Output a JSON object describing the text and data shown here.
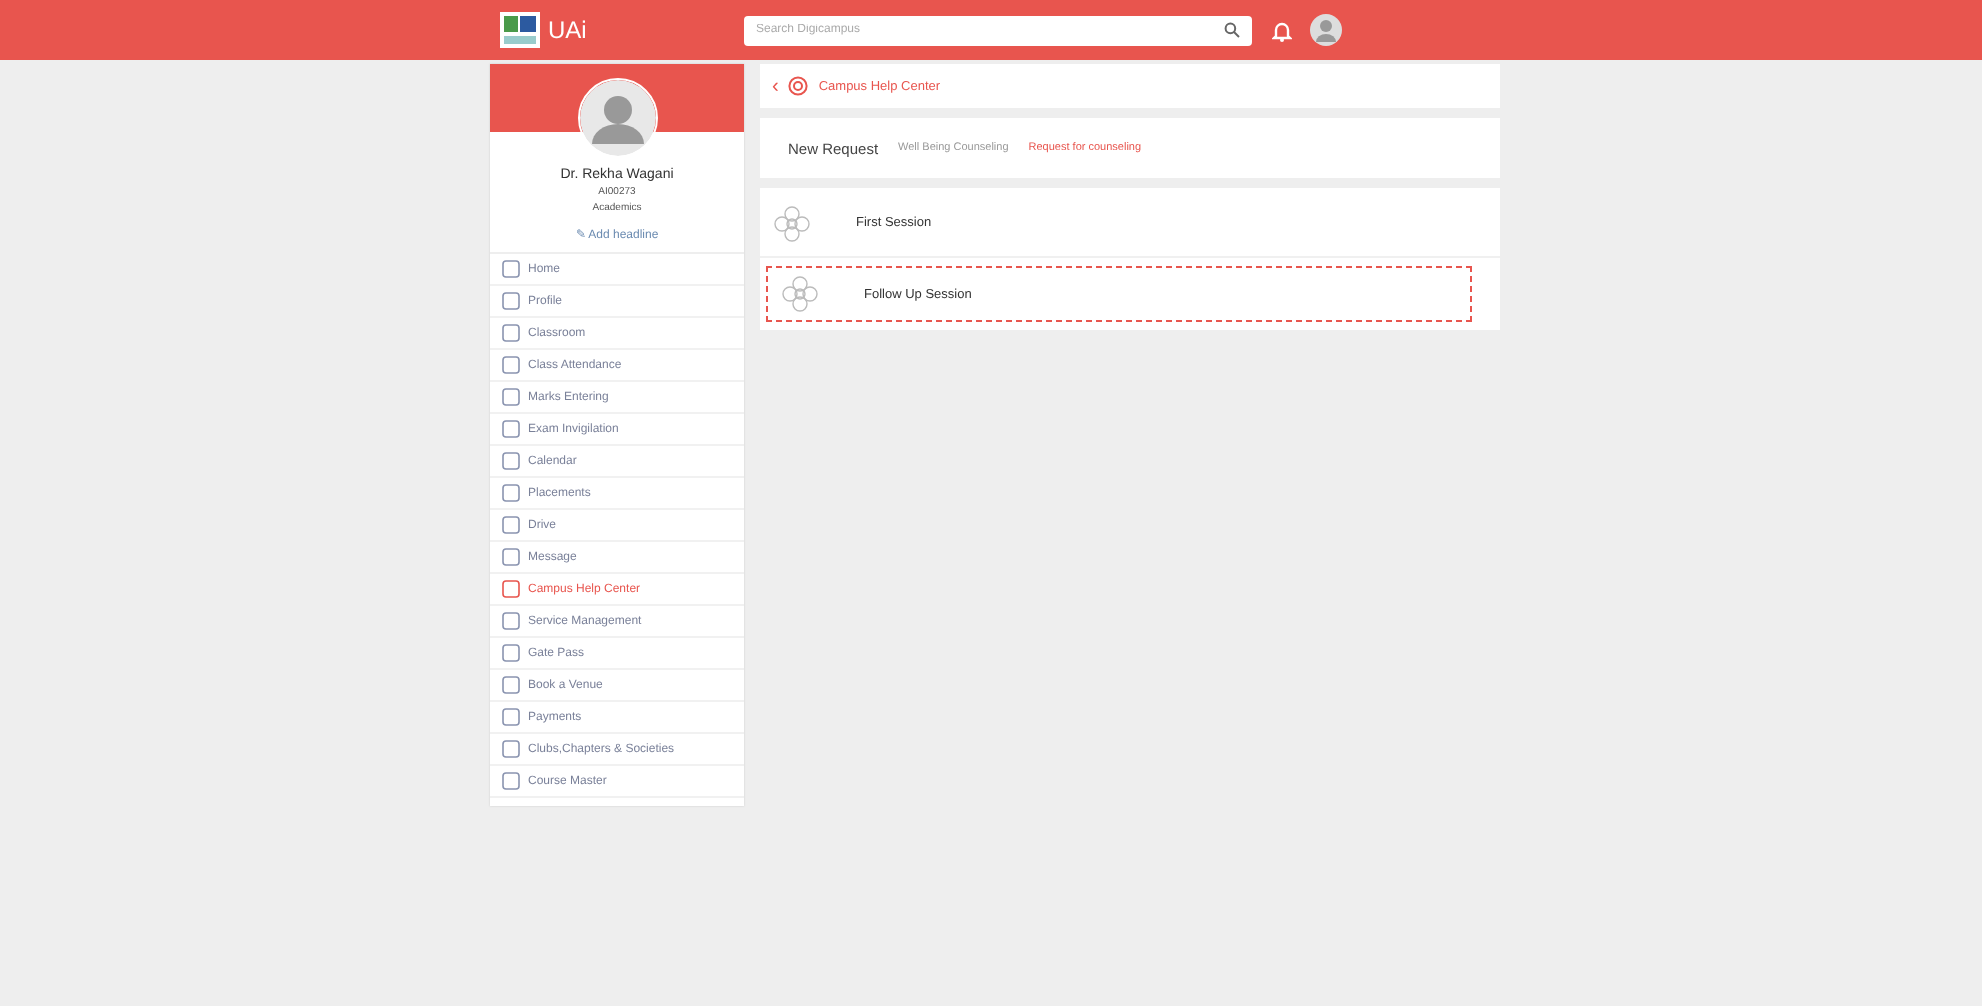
{
  "topbar": {
    "logo_text": "UAi",
    "search": {
      "placeholder": "Search Digicampus"
    }
  },
  "profile": {
    "name": "Dr. Rekha Wagani",
    "id": "AI00273",
    "department": "Academics",
    "headline_link": "✎ Add headline"
  },
  "menu": [
    {
      "label": "Home",
      "selected": false
    },
    {
      "label": "Profile",
      "selected": false
    },
    {
      "label": "Classroom",
      "selected": false
    },
    {
      "label": "Class Attendance",
      "selected": false
    },
    {
      "label": "Marks Entering",
      "selected": false
    },
    {
      "label": "Exam Invigilation",
      "selected": false
    },
    {
      "label": "Calendar",
      "selected": false
    },
    {
      "label": "Placements",
      "selected": false
    },
    {
      "label": "Drive",
      "selected": false
    },
    {
      "label": "Message",
      "selected": false
    },
    {
      "label": "Campus Help Center",
      "selected": true
    },
    {
      "label": "Service Management",
      "selected": false
    },
    {
      "label": "Gate Pass",
      "selected": false
    },
    {
      "label": "Book a Venue",
      "selected": false
    },
    {
      "label": "Payments",
      "selected": false
    },
    {
      "label": "Clubs,Chapters & Societies",
      "selected": false
    },
    {
      "label": "Course Master",
      "selected": false
    }
  ],
  "header": {
    "back": "‹",
    "title": "Campus Help Center"
  },
  "request": {
    "title": "New Request",
    "steps": [
      {
        "label": "Well Being Counseling",
        "selected": false
      },
      {
        "label": "Request for counseling",
        "selected": true
      }
    ]
  },
  "sessions": [
    {
      "label": "First Session",
      "selected": false
    },
    {
      "label": "Follow Up Session",
      "selected": true
    }
  ]
}
